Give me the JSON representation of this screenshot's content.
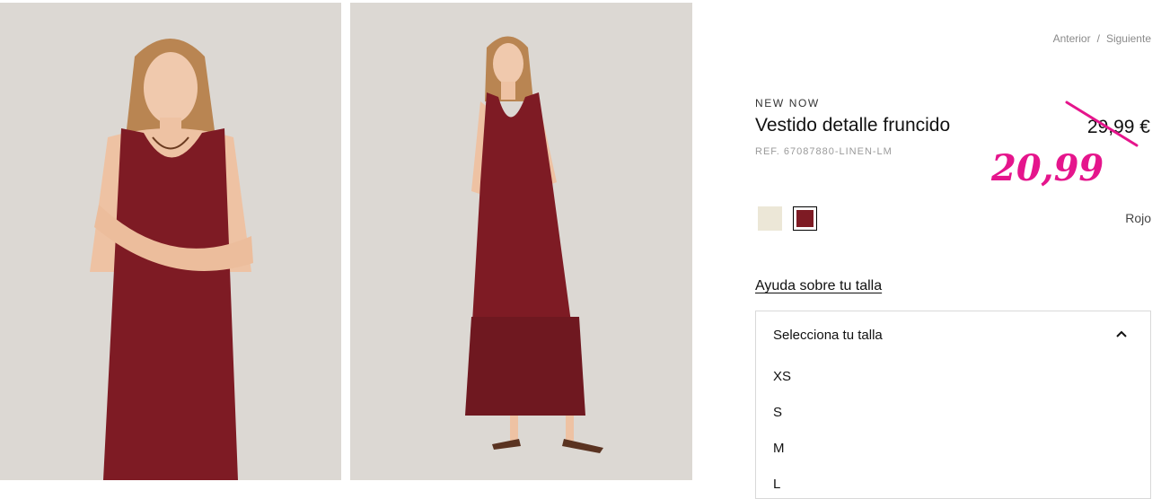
{
  "nav": {
    "prev": "Anterior",
    "separator": "/",
    "next": "Siguiente"
  },
  "product": {
    "label": "NEW NOW",
    "title": "Vestido detalle fruncido",
    "ref": "REF. 67087880-LINEN-LM",
    "old_price": "29,99 €",
    "sale_price": "20,99"
  },
  "colors": {
    "swatches": [
      {
        "name": "cream-swatch",
        "hex": "#ece7d7"
      },
      {
        "name": "red-swatch",
        "hex": "#7e1b24",
        "selected": true
      }
    ],
    "selected_name": "Rojo"
  },
  "size_help": "Ayuda sobre tu talla",
  "size_dropdown": {
    "placeholder": "Selecciona tu talla",
    "options": [
      "XS",
      "S",
      "M",
      "L"
    ]
  },
  "accent_colors": {
    "sale": "#e5158c",
    "dress": "#7e1b24"
  }
}
